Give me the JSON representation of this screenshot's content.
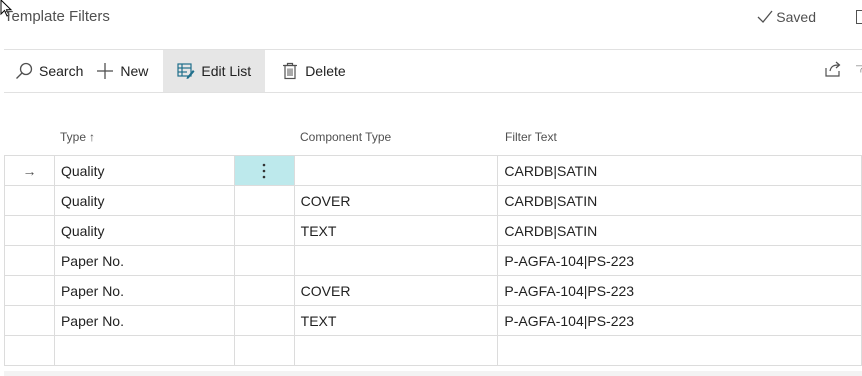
{
  "page": {
    "title": "Template Filters",
    "saved_label": "Saved"
  },
  "toolbar": {
    "search_label": "Search",
    "new_label": "New",
    "edit_list_label": "Edit List",
    "delete_label": "Delete"
  },
  "grid": {
    "columns": {
      "type": "Type",
      "component_type": "Component Type",
      "filter_text": "Filter Text"
    },
    "sort_indicator": "↑",
    "current_row_indicator": "→",
    "rows": [
      {
        "type": "Quality",
        "component_type": "",
        "filter_text": "CARDB|SATIN"
      },
      {
        "type": "Quality",
        "component_type": "COVER",
        "filter_text": "CARDB|SATIN"
      },
      {
        "type": "Quality",
        "component_type": "TEXT",
        "filter_text": "CARDB|SATIN"
      },
      {
        "type": "Paper No.",
        "component_type": "",
        "filter_text": "P-AGFA-104|PS-223"
      },
      {
        "type": "Paper No.",
        "component_type": "COVER",
        "filter_text": "P-AGFA-104|PS-223"
      },
      {
        "type": "Paper No.",
        "component_type": "TEXT",
        "filter_text": "P-AGFA-104|PS-223"
      }
    ]
  },
  "colors": {
    "accent_selected_cell": "#bde9ec",
    "toolbar_active": "#e6e6e6"
  }
}
